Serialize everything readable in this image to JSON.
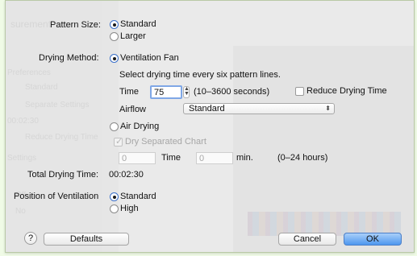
{
  "pattern_size": {
    "label": "Pattern Size:",
    "options": [
      "Standard",
      "Larger"
    ],
    "selected": "Standard"
  },
  "drying_method": {
    "label": "Drying Method:",
    "ventilation_fan": {
      "label": "Ventilation Fan",
      "selected": true,
      "description": "Select drying time every six pattern lines.",
      "time_label": "Time",
      "time_value": "75",
      "time_range": "(10–3600 seconds)",
      "reduce_label": "Reduce Drying Time",
      "reduce_checked": false,
      "airflow_label": "Airflow",
      "airflow_value": "Standard"
    },
    "air_drying": {
      "label": "Air Drying",
      "selected": false,
      "dry_separated_label": "Dry Separated Chart",
      "dry_separated_checked": true,
      "hours_value": "0",
      "time_label": "Time",
      "min_value": "0",
      "min_label": "min.",
      "range_label": "(0–24 hours)"
    }
  },
  "total_drying_time": {
    "label": "Total Drying Time:",
    "value": "00:02:30"
  },
  "position_of_ventilation": {
    "label": "Position of Ventilation",
    "options": [
      "Standard",
      "High"
    ],
    "selected": "Standard"
  },
  "buttons": {
    "help": "?",
    "defaults": "Defaults",
    "cancel": "Cancel",
    "ok": "OK"
  },
  "background_ghost": {
    "items": [
      "surement",
      "Preferences",
      "Standard",
      "Separate Settings",
      "00:02:30",
      "Reduce Drying Time",
      "Settings",
      "Off",
      "No"
    ]
  },
  "colors": {
    "accent": "#4e97ef",
    "page_background": "#f0fbe6",
    "sheet_background": "#eaeaea"
  }
}
